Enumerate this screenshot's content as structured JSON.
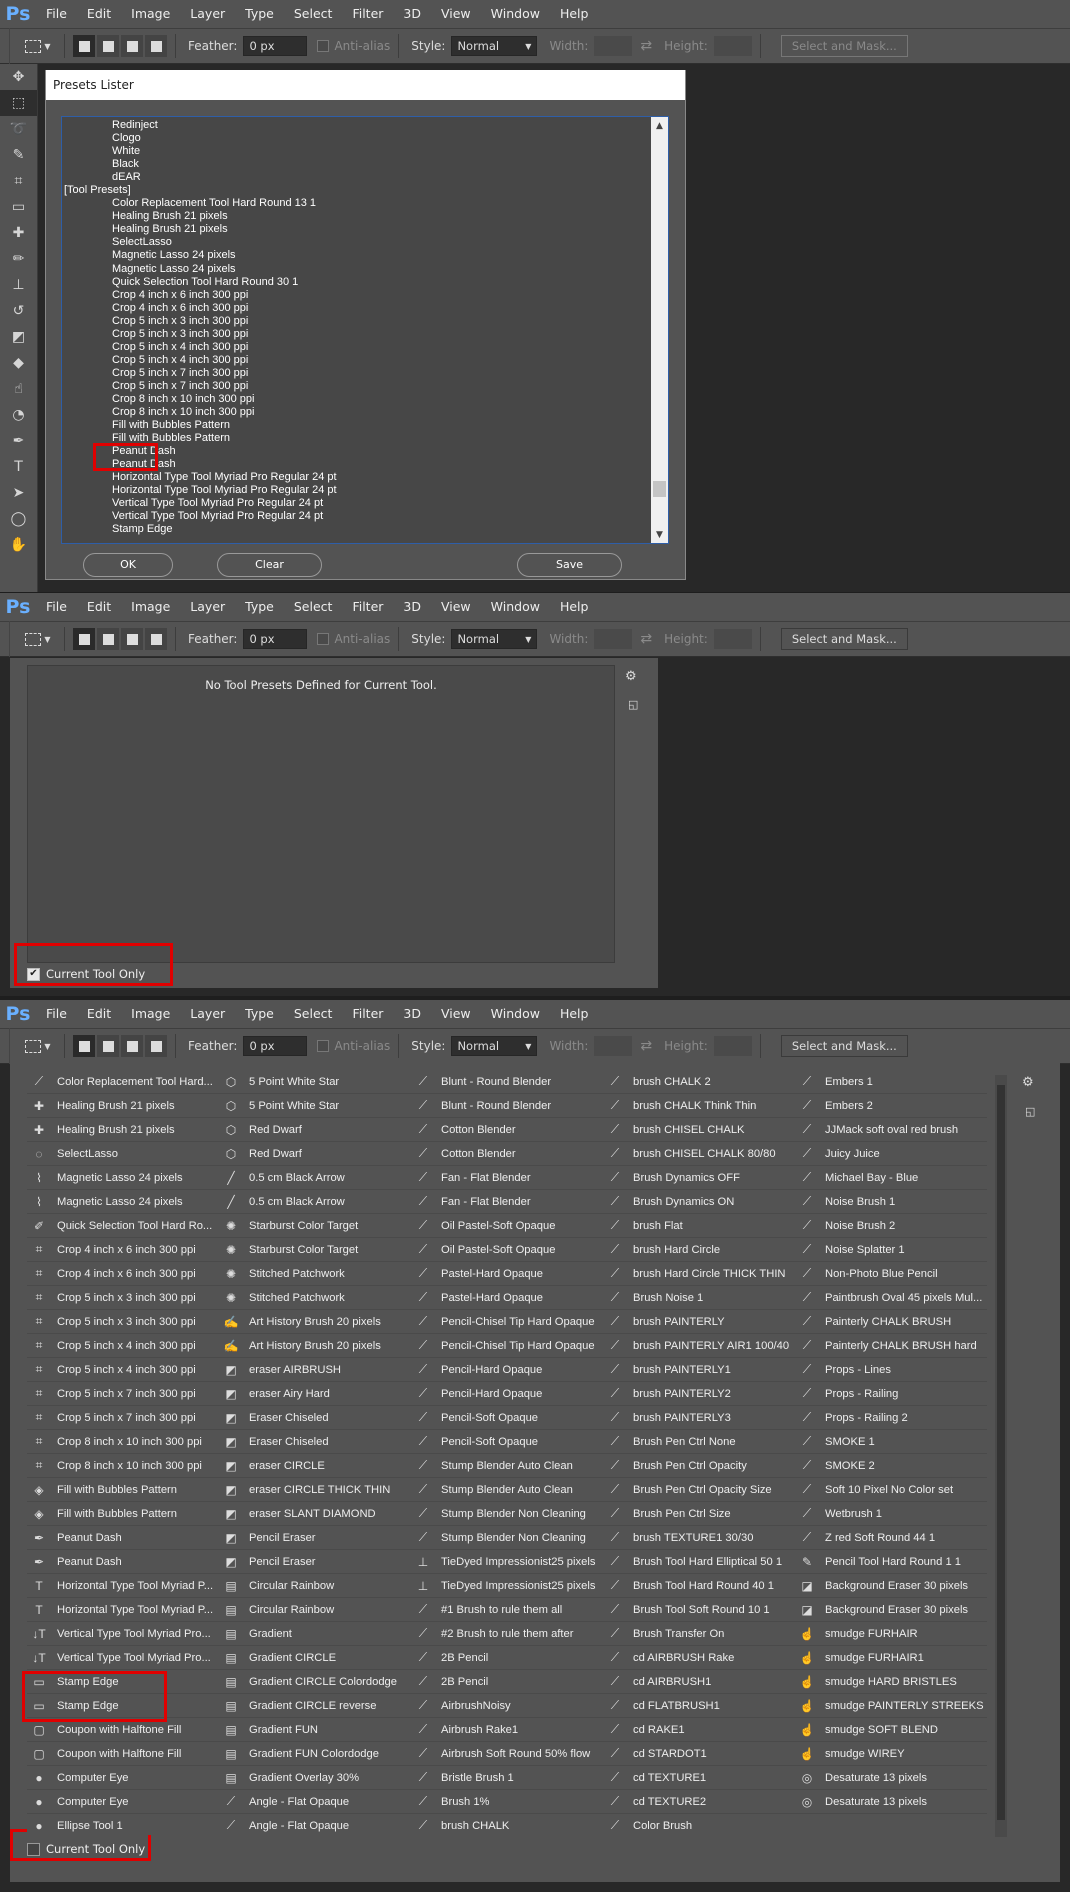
{
  "app": {
    "logo": "Ps",
    "menu": [
      "File",
      "Edit",
      "Image",
      "Layer",
      "Type",
      "Select",
      "Filter",
      "3D",
      "View",
      "Window",
      "Help"
    ]
  },
  "options_bar": {
    "feather_label": "Feather:",
    "feather_value": "0 px",
    "anti_alias_label": "Anti-alias",
    "style_label": "Style:",
    "style_value": "Normal",
    "width_label": "Width:",
    "height_label": "Height:",
    "select_mask_label": "Select and Mask..."
  },
  "dialog": {
    "title": "Presets Lister",
    "lines": [
      {
        "text": "Redinject",
        "indent": true
      },
      {
        "text": "Clogo",
        "indent": true
      },
      {
        "text": "White",
        "indent": true
      },
      {
        "text": "Black",
        "indent": true
      },
      {
        "text": "dEAR",
        "indent": true
      },
      {
        "text": "[Tool Presets]",
        "indent": false
      },
      {
        "text": "Color Replacement Tool Hard Round 13 1",
        "indent": true
      },
      {
        "text": "Healing Brush 21 pixels",
        "indent": true
      },
      {
        "text": "Healing Brush 21 pixels",
        "indent": true
      },
      {
        "text": "SelectLasso",
        "indent": true
      },
      {
        "text": "Magnetic Lasso 24 pixels",
        "indent": true
      },
      {
        "text": "Magnetic Lasso 24 pixels",
        "indent": true
      },
      {
        "text": "Quick Selection Tool Hard Round 30 1",
        "indent": true
      },
      {
        "text": "Crop 4 inch x 6 inch 300 ppi",
        "indent": true
      },
      {
        "text": "Crop 4 inch x 6 inch 300 ppi",
        "indent": true
      },
      {
        "text": "Crop 5 inch x 3 inch 300 ppi",
        "indent": true
      },
      {
        "text": "Crop 5 inch x 3 inch 300 ppi",
        "indent": true
      },
      {
        "text": "Crop 5 inch x 4 inch 300 ppi",
        "indent": true
      },
      {
        "text": "Crop 5 inch x 4 inch 300 ppi",
        "indent": true
      },
      {
        "text": "Crop 5 inch x 7 inch 300 ppi",
        "indent": true
      },
      {
        "text": "Crop 5 inch x 7 inch 300 ppi",
        "indent": true
      },
      {
        "text": "Crop 8 inch x 10 inch 300 ppi",
        "indent": true
      },
      {
        "text": "Crop 8 inch x 10 inch 300 ppi",
        "indent": true
      },
      {
        "text": "Fill with Bubbles Pattern",
        "indent": true
      },
      {
        "text": "Fill with Bubbles Pattern",
        "indent": true
      },
      {
        "text": "Peanut Dash",
        "indent": true
      },
      {
        "text": "Peanut Dash",
        "indent": true
      },
      {
        "text": "Horizontal Type Tool Myriad Pro Regular 24 pt",
        "indent": true
      },
      {
        "text": "Horizontal Type Tool Myriad Pro Regular 24 pt",
        "indent": true
      },
      {
        "text": "Vertical Type Tool Myriad Pro Regular 24 pt",
        "indent": true
      },
      {
        "text": "Vertical Type Tool Myriad Pro Regular 24 pt",
        "indent": true
      },
      {
        "text": "Stamp Edge",
        "indent": true
      }
    ],
    "ok_label": "OK",
    "clear_label": "Clear",
    "save_label": "Save"
  },
  "panel_empty": {
    "message": "No Tool Presets Defined for Current Tool.",
    "current_tool_only_label": "Current Tool Only",
    "current_tool_only_checked": true
  },
  "panel_grid": {
    "current_tool_only_label": "Current Tool Only",
    "current_tool_only_checked": false,
    "columns": [
      [
        {
          "icon": "brush-icon",
          "label": "Color Replacement Tool Hard..."
        },
        {
          "icon": "bandage-icon",
          "label": "Healing Brush 21 pixels"
        },
        {
          "icon": "bandage-icon",
          "label": "Healing Brush 21 pixels"
        },
        {
          "icon": "lasso-icon",
          "label": "SelectLasso"
        },
        {
          "icon": "magnetic-lasso-icon",
          "label": "Magnetic Lasso 24 pixels"
        },
        {
          "icon": "magnetic-lasso-icon",
          "label": "Magnetic Lasso 24 pixels"
        },
        {
          "icon": "quick-selection-icon",
          "label": "Quick Selection Tool Hard Ro..."
        },
        {
          "icon": "crop-icon",
          "label": "Crop 4 inch x 6 inch 300 ppi"
        },
        {
          "icon": "crop-icon",
          "label": "Crop 4 inch x 6 inch 300 ppi"
        },
        {
          "icon": "crop-icon",
          "label": "Crop 5 inch x 3 inch 300 ppi"
        },
        {
          "icon": "crop-icon",
          "label": "Crop 5 inch x 3 inch 300 ppi"
        },
        {
          "icon": "crop-icon",
          "label": "Crop 5 inch x 4 inch 300 ppi"
        },
        {
          "icon": "crop-icon",
          "label": "Crop 5 inch x 4 inch 300 ppi"
        },
        {
          "icon": "crop-icon",
          "label": "Crop 5 inch x 7 inch 300 ppi"
        },
        {
          "icon": "crop-icon",
          "label": "Crop 5 inch x 7 inch 300 ppi"
        },
        {
          "icon": "crop-icon",
          "label": "Crop 8 inch x 10 inch 300 ppi"
        },
        {
          "icon": "crop-icon",
          "label": "Crop 8 inch x 10 inch 300 ppi"
        },
        {
          "icon": "paint-bucket-icon",
          "label": "Fill with Bubbles Pattern"
        },
        {
          "icon": "paint-bucket-icon",
          "label": "Fill with Bubbles Pattern"
        },
        {
          "icon": "pen-icon",
          "label": "Peanut Dash"
        },
        {
          "icon": "pen-icon",
          "label": "Peanut Dash"
        },
        {
          "icon": "type-icon",
          "label": "Horizontal Type Tool Myriad P..."
        },
        {
          "icon": "type-icon",
          "label": "Horizontal Type Tool Myriad P..."
        },
        {
          "icon": "vertical-type-icon",
          "label": "Vertical Type Tool Myriad Pro..."
        },
        {
          "icon": "vertical-type-icon",
          "label": "Vertical Type Tool Myriad Pro..."
        },
        {
          "icon": "rectangle-icon",
          "label": "Stamp Edge"
        },
        {
          "icon": "rectangle-icon",
          "label": "Stamp Edge"
        },
        {
          "icon": "rounded-rect-icon",
          "label": "Coupon with Halftone Fill"
        },
        {
          "icon": "rounded-rect-icon",
          "label": "Coupon with Halftone Fill"
        },
        {
          "icon": "ellipse-icon",
          "label": "Computer Eye"
        },
        {
          "icon": "ellipse-icon",
          "label": "Computer Eye"
        },
        {
          "icon": "ellipse-icon",
          "label": "Ellipse Tool 1"
        }
      ],
      [
        {
          "icon": "polygon-icon",
          "label": "5 Point White Star"
        },
        {
          "icon": "polygon-icon",
          "label": "5 Point White Star"
        },
        {
          "icon": "polygon-icon",
          "label": "Red Dwarf"
        },
        {
          "icon": "polygon-icon",
          "label": "Red Dwarf"
        },
        {
          "icon": "line-icon",
          "label": "0.5 cm Black Arrow"
        },
        {
          "icon": "line-icon",
          "label": "0.5 cm Black Arrow"
        },
        {
          "icon": "custom-shape-icon",
          "label": "Starburst Color Target"
        },
        {
          "icon": "custom-shape-icon",
          "label": "Starburst Color Target"
        },
        {
          "icon": "custom-shape-icon",
          "label": "Stitched Patchwork"
        },
        {
          "icon": "custom-shape-icon",
          "label": "Stitched Patchwork"
        },
        {
          "icon": "art-history-brush-icon",
          "label": "Art History Brush 20 pixels"
        },
        {
          "icon": "art-history-brush-icon",
          "label": "Art History Brush 20 pixels"
        },
        {
          "icon": "eraser-icon",
          "label": "eraser AIRBRUSH"
        },
        {
          "icon": "eraser-icon",
          "label": "eraser Airy Hard"
        },
        {
          "icon": "eraser-icon",
          "label": "Eraser Chiseled"
        },
        {
          "icon": "eraser-icon",
          "label": "Eraser Chiseled"
        },
        {
          "icon": "eraser-icon",
          "label": "eraser CIRCLE"
        },
        {
          "icon": "eraser-icon",
          "label": "eraser CIRCLE THICK THIN"
        },
        {
          "icon": "eraser-icon",
          "label": "eraser SLANT DIAMOND"
        },
        {
          "icon": "eraser-icon",
          "label": "Pencil Eraser"
        },
        {
          "icon": "eraser-icon",
          "label": "Pencil Eraser"
        },
        {
          "icon": "gradient-icon",
          "label": "Circular Rainbow"
        },
        {
          "icon": "gradient-icon",
          "label": "Circular Rainbow"
        },
        {
          "icon": "gradient-icon",
          "label": "Gradient"
        },
        {
          "icon": "gradient-icon",
          "label": "Gradient CIRCLE"
        },
        {
          "icon": "gradient-icon",
          "label": "Gradient CIRCLE Colordodge"
        },
        {
          "icon": "gradient-icon",
          "label": "Gradient CIRCLE reverse"
        },
        {
          "icon": "gradient-icon",
          "label": "Gradient FUN"
        },
        {
          "icon": "gradient-icon",
          "label": "Gradient FUN Colordodge"
        },
        {
          "icon": "gradient-icon",
          "label": "Gradient Overlay 30%"
        },
        {
          "icon": "mixer-brush-icon",
          "label": "Angle - Flat Opaque"
        },
        {
          "icon": "mixer-brush-icon",
          "label": "Angle - Flat Opaque"
        }
      ],
      [
        {
          "icon": "mixer-brush-icon",
          "label": "Blunt - Round Blender"
        },
        {
          "icon": "mixer-brush-icon",
          "label": "Blunt - Round Blender"
        },
        {
          "icon": "mixer-brush-icon",
          "label": "Cotton Blender"
        },
        {
          "icon": "mixer-brush-icon",
          "label": "Cotton Blender"
        },
        {
          "icon": "mixer-brush-icon",
          "label": "Fan - Flat Blender"
        },
        {
          "icon": "mixer-brush-icon",
          "label": "Fan - Flat Blender"
        },
        {
          "icon": "mixer-brush-icon",
          "label": "Oil Pastel-Soft Opaque"
        },
        {
          "icon": "mixer-brush-icon",
          "label": "Oil Pastel-Soft Opaque"
        },
        {
          "icon": "mixer-brush-icon",
          "label": "Pastel-Hard Opaque"
        },
        {
          "icon": "mixer-brush-icon",
          "label": "Pastel-Hard Opaque"
        },
        {
          "icon": "mixer-brush-icon",
          "label": "Pencil-Chisel Tip Hard Opaque"
        },
        {
          "icon": "mixer-brush-icon",
          "label": "Pencil-Chisel Tip Hard Opaque"
        },
        {
          "icon": "mixer-brush-icon",
          "label": "Pencil-Hard Opaque"
        },
        {
          "icon": "mixer-brush-icon",
          "label": "Pencil-Hard Opaque"
        },
        {
          "icon": "mixer-brush-icon",
          "label": "Pencil-Soft Opaque"
        },
        {
          "icon": "mixer-brush-icon",
          "label": "Pencil-Soft Opaque"
        },
        {
          "icon": "mixer-brush-icon",
          "label": "Stump Blender Auto Clean"
        },
        {
          "icon": "mixer-brush-icon",
          "label": "Stump Blender Auto Clean"
        },
        {
          "icon": "mixer-brush-icon",
          "label": "Stump Blender Non Cleaning"
        },
        {
          "icon": "mixer-brush-icon",
          "label": "Stump Blender Non Cleaning"
        },
        {
          "icon": "stamp-icon",
          "label": "TieDyed Impressionist25 pixels"
        },
        {
          "icon": "stamp-icon",
          "label": "TieDyed Impressionist25 pixels"
        },
        {
          "icon": "brush-icon",
          "label": "#1 Brush to rule them all"
        },
        {
          "icon": "brush-icon",
          "label": "#2 Brush to rule them after"
        },
        {
          "icon": "brush-icon",
          "label": "2B Pencil"
        },
        {
          "icon": "brush-icon",
          "label": "2B Pencil"
        },
        {
          "icon": "brush-icon",
          "label": "AirbrushNoisy"
        },
        {
          "icon": "brush-icon",
          "label": "Airbrush Rake1"
        },
        {
          "icon": "brush-icon",
          "label": "Airbrush Soft Round 50% flow"
        },
        {
          "icon": "brush-icon",
          "label": "Bristle Brush 1"
        },
        {
          "icon": "brush-icon",
          "label": "Brush 1%"
        },
        {
          "icon": "brush-icon",
          "label": "brush CHALK"
        }
      ],
      [
        {
          "icon": "brush-icon",
          "label": "brush CHALK 2"
        },
        {
          "icon": "brush-icon",
          "label": "brush CHALK Think Thin"
        },
        {
          "icon": "brush-icon",
          "label": "brush CHISEL CHALK"
        },
        {
          "icon": "brush-icon",
          "label": "brush CHISEL CHALK 80/80"
        },
        {
          "icon": "brush-icon",
          "label": "Brush Dynamics OFF"
        },
        {
          "icon": "brush-icon",
          "label": "Brush Dynamics ON"
        },
        {
          "icon": "brush-icon",
          "label": "brush Flat"
        },
        {
          "icon": "brush-icon",
          "label": "brush Hard Circle"
        },
        {
          "icon": "brush-icon",
          "label": "brush Hard Circle THICK THIN"
        },
        {
          "icon": "brush-icon",
          "label": "Brush Noise 1"
        },
        {
          "icon": "brush-icon",
          "label": "brush PAINTERLY"
        },
        {
          "icon": "brush-icon",
          "label": "brush PAINTERLY AIR1 100/40"
        },
        {
          "icon": "brush-icon",
          "label": "brush PAINTERLY1"
        },
        {
          "icon": "brush-icon",
          "label": "brush PAINTERLY2"
        },
        {
          "icon": "brush-icon",
          "label": "brush PAINTERLY3"
        },
        {
          "icon": "brush-icon",
          "label": "Brush Pen Ctrl None"
        },
        {
          "icon": "brush-icon",
          "label": "Brush Pen Ctrl Opacity"
        },
        {
          "icon": "brush-icon",
          "label": "Brush Pen Ctrl Opacity Size"
        },
        {
          "icon": "brush-icon",
          "label": "Brush Pen Ctrl Size"
        },
        {
          "icon": "brush-icon",
          "label": "brush TEXTURE1 30/30"
        },
        {
          "icon": "brush-icon",
          "label": "Brush Tool Hard Elliptical 50 1"
        },
        {
          "icon": "brush-icon",
          "label": "Brush Tool Hard Round 40 1"
        },
        {
          "icon": "brush-icon",
          "label": "Brush Tool Soft Round 10 1"
        },
        {
          "icon": "brush-icon",
          "label": "Brush Transfer On"
        },
        {
          "icon": "brush-icon",
          "label": "cd AIRBRUSH Rake"
        },
        {
          "icon": "brush-icon",
          "label": "cd AIRBRUSH1"
        },
        {
          "icon": "brush-icon",
          "label": "cd FLATBRUSH1"
        },
        {
          "icon": "brush-icon",
          "label": "cd RAKE1"
        },
        {
          "icon": "brush-icon",
          "label": "cd STARDOT1"
        },
        {
          "icon": "brush-icon",
          "label": "cd TEXTURE1"
        },
        {
          "icon": "brush-icon",
          "label": "cd TEXTURE2"
        },
        {
          "icon": "brush-icon",
          "label": "Color Brush"
        }
      ],
      [
        {
          "icon": "brush-icon",
          "label": "Embers 1"
        },
        {
          "icon": "brush-icon",
          "label": "Embers 2"
        },
        {
          "icon": "brush-icon",
          "label": "JJMack soft oval red brush"
        },
        {
          "icon": "brush-icon",
          "label": "Juicy Juice"
        },
        {
          "icon": "brush-icon",
          "label": "Michael Bay - Blue"
        },
        {
          "icon": "brush-icon",
          "label": "Noise Brush 1"
        },
        {
          "icon": "brush-icon",
          "label": "Noise Brush 2"
        },
        {
          "icon": "brush-icon",
          "label": "Noise Splatter 1"
        },
        {
          "icon": "brush-icon",
          "label": "Non-Photo Blue Pencil"
        },
        {
          "icon": "brush-icon",
          "label": "Paintbrush Oval 45 pixels Mul..."
        },
        {
          "icon": "brush-icon",
          "label": "Painterly CHALK BRUSH"
        },
        {
          "icon": "brush-icon",
          "label": "Painterly CHALK BRUSH hard"
        },
        {
          "icon": "brush-icon",
          "label": "Props - Lines"
        },
        {
          "icon": "brush-icon",
          "label": "Props - Railing"
        },
        {
          "icon": "brush-icon",
          "label": "Props - Railing 2"
        },
        {
          "icon": "brush-icon",
          "label": "SMOKE 1"
        },
        {
          "icon": "brush-icon",
          "label": "SMOKE 2"
        },
        {
          "icon": "brush-icon",
          "label": "Soft  10 Pixel No Color set"
        },
        {
          "icon": "brush-icon",
          "label": "Wetbrush 1"
        },
        {
          "icon": "brush-icon",
          "label": "Z red Soft Round 44 1"
        },
        {
          "icon": "pencil-icon",
          "label": "Pencil Tool Hard Round 1 1"
        },
        {
          "icon": "background-eraser-icon",
          "label": "Background Eraser 30 pixels"
        },
        {
          "icon": "background-eraser-icon",
          "label": "Background Eraser 30 pixels"
        },
        {
          "icon": "smudge-icon",
          "label": "smudge FURHAIR"
        },
        {
          "icon": "smudge-icon",
          "label": "smudge FURHAIR1"
        },
        {
          "icon": "smudge-icon",
          "label": "smudge HARD BRISTLES"
        },
        {
          "icon": "smudge-icon",
          "label": "smudge PAINTERLY STREEKS"
        },
        {
          "icon": "smudge-icon",
          "label": "smudge SOFT BLEND"
        },
        {
          "icon": "smudge-icon",
          "label": "smudge WIREY"
        },
        {
          "icon": "sponge-icon",
          "label": "Desaturate 13 pixels"
        },
        {
          "icon": "sponge-icon",
          "label": "Desaturate 13 pixels"
        }
      ]
    ]
  },
  "colors": {
    "highlight": "#e00000",
    "ps_blue": "#6ab0ff"
  }
}
